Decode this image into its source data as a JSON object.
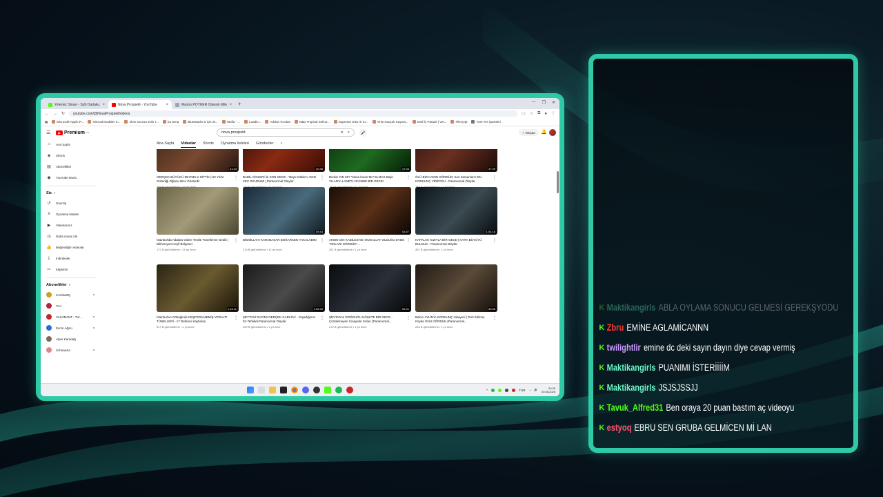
{
  "browser": {
    "tabs": [
      {
        "title": "Yetenez Sinavi - Sizli Dadaku...",
        "color": "#53fc18"
      },
      {
        "title": "Nova Prospekt - YouTube",
        "color": "#ff0000"
      },
      {
        "title": "Masno POYKER Ölüesin Mile...",
        "color": "#9aa5b8"
      }
    ],
    "new_tab_glyph": "+",
    "url": "youtube.com/@NovaProspekt/videos",
    "bookmarks": [
      "Microsoft Apple iP...",
      "Nimrod Modüler K...",
      "ohne soccsu senir t...",
      "bu tema",
      "BlueStacks 5 için W...",
      "Tasfia - ...",
      "Loadin...",
      "Adobe Acrobat",
      "N&D Tropical Select...",
      "Supreset Orta Hi Kr...",
      "Tinie Kauçuk Kayma...",
      "Kedi İç Parazit | Vet...",
      "Filecrypt",
      "Tüm Yer İşaretleri"
    ]
  },
  "youtube": {
    "logo_text": "Premium",
    "logo_sup": "TR",
    "search_value": "nova prospekt",
    "create_label": "Oluştur",
    "sidebar": {
      "main": [
        {
          "icon": "home-icon",
          "glyph": "⌂",
          "label": "Ana Sayfa"
        },
        {
          "icon": "shorts-icon",
          "glyph": "◈",
          "label": "Shorts"
        },
        {
          "icon": "subscriptions-icon",
          "glyph": "▤",
          "label": "Abonelikler"
        },
        {
          "icon": "music-icon",
          "glyph": "◉",
          "label": "YouTube Music"
        }
      ],
      "you_heading": "Siz",
      "you": [
        {
          "icon": "history-icon",
          "glyph": "↺",
          "label": "Geçmiş"
        },
        {
          "icon": "playlists-icon",
          "glyph": "≡",
          "label": "Oynatma listeleri"
        },
        {
          "icon": "your-videos-icon",
          "glyph": "▶",
          "label": "Videolarınız"
        },
        {
          "icon": "watch-later-icon",
          "glyph": "◷",
          "label": "Daha sonra izle"
        },
        {
          "icon": "liked-icon",
          "glyph": "👍",
          "label": "Beğendiğim videolar"
        },
        {
          "icon": "downloads-icon",
          "glyph": "⤓",
          "label": "İndirilenler"
        },
        {
          "icon": "clips-icon",
          "glyph": "✂",
          "label": "Kliplerim"
        }
      ],
      "subs_heading": "Abonelikler",
      "subs": [
        {
          "label": "CombatRy",
          "color": "#c9a030",
          "dot": true
        },
        {
          "label": "TAA",
          "color": "#b8243a",
          "dot": false
        },
        {
          "label": "VALORANT - Tür...",
          "color": "#c4262e",
          "dot": true
        },
        {
          "label": "Evrim Ağacı",
          "color": "#2a6bd4",
          "dot": true
        },
        {
          "label": "Alper Karadağ",
          "color": "#7a6a60",
          "dot": false
        },
        {
          "label": "Schnwsna",
          "color": "#d88a8a",
          "dot": true
        }
      ]
    },
    "channel_tabs": [
      "Ana Sayfa",
      "Videolar",
      "Shorts",
      "Oynatma listeleri",
      "Gönderiler"
    ],
    "active_tab": "Videolar",
    "videos": [
      {
        "title": "GERÇEK BÜYÜCÜ ZEYNEL'e GİTTİK | 60 Yıldır Gizlediği Oğlunu Bize Gösterdi!",
        "meta": "464 B görüntüleme • 10 ay önce",
        "duration": "31:33",
        "bg": "linear-gradient(135deg,#3a2418,#7a4a30 55%,#241410)"
      },
      {
        "title": "BABİL CİNLERİ ile SON GECE - 'Büyü Kitabı'nı SON KEZ OKUDUM! | Paranormal Olaylar",
        "meta": "192 B görüntüleme • 11 ay önce",
        "duration": "40:48",
        "bg": "linear-gradient(135deg,#2a0a08,#8a2a12 50%,#3a0c06)"
      },
      {
        "title": "Bunlar CİN Mİ? Yoksa İnsan Mı? ELMAS Başlı YILAN'ın LANETLİ EVİNDE BİR GECE!",
        "meta": "173 B görüntüleme • 11 ay önce",
        "duration": "47:46",
        "bg": "linear-gradient(135deg,#0a2a0c,#1f6a20 55%,#061a06)"
      },
      {
        "title": "ÖLÜ BİR KADIN GÖRDÜK! Son Zamanların EN KORKUNÇ VİDEOSU - Paranormal Olaylar",
        "meta": "384 B görüntüleme • 11 ay önce",
        "duration": "47:39",
        "bg": "linear-gradient(135deg,#2a1410,#6a3020 50%,#1a0a08)"
      },
      {
        "title": "İstanbul'da Adalara Giden Yeraltı Tünellerine Girdik | Bilinmeyen Keşif Belgesel",
        "meta": "172 B görüntüleme • 11 ay önce",
        "duration": "",
        "bg": "linear-gradient(135deg,#6a6448,#a29a78 50%,#4a4630)"
      },
      {
        "title": "BİSMİLLAH! KARABASAN BOĞARKEN YAKALADIK!",
        "meta": "214 B görüntüleme • 11 ay önce",
        "duration": "59:43",
        "bg": "linear-gradient(135deg,#1a2a3a,#4a6a7a 55%,#101a20)"
      },
      {
        "title": "AMON CİN KABİLESİ'nin MUSALLAT OLDUĞU EVDE \"ONLARI GÖRDÜK\"...",
        "meta": "261 B görüntüleme • 1 yıl önce",
        "duration": "51:57",
        "bg": "linear-gradient(135deg,#1a1008,#5a3018 50%,#0a0604)"
      },
      {
        "title": "KAPALAK KIZIYLA BİR GECE | KARA BÜYÜYÜ BULDUK - Paranormal Olaylar",
        "meta": "467 B görüntüleme • 1 yıl önce",
        "duration": "1:04:18",
        "bg": "linear-gradient(135deg,#0c1418,#3a4a50 55%,#080c10)"
      },
      {
        "title": "İstanbul'un Göbeğinde KEŞFEDİLMEMİŞ YERALTI TÜNELLERİ - 17 Defineci Kayboldu",
        "meta": "517 B görüntüleme • 1 yıl önce",
        "duration": "1:16:11",
        "bg": "linear-gradient(135deg,#2a2414,#6a5a30 50%,#1a1408)"
      },
      {
        "title": "ŞEYTANİ RACİM! GERÇEK CADI EVİ - Yaşadığımız En Tehlikeli Paranormal Olaylar",
        "meta": "359 B görüntüleme • 1 yıl önce",
        "duration": "1:05:40",
        "bg": "linear-gradient(135deg,#1a1a1a,#4a4a4a 55%,#0e0e0e)"
      },
      {
        "title": "ŞEYTAN'ın DOĞDUĞU KÖŞKTE BİR GECE - Çözülemeyen Cinayetin Sırları (Paranormal...",
        "meta": "272 B görüntüleme • 1 yıl önce",
        "duration": "52:01",
        "bg": "linear-gradient(135deg,#0a0c10,#2a3038 55%,#050608)"
      },
      {
        "title": "Bakıcı AYLİN'in KORKUNÇ Hikayesi | Terk Edilmiş Köyde ONU GÖRDÜK (Paranormal...",
        "meta": "263 B görüntüleme • 1 yıl önce",
        "duration": "56:58",
        "bg": "linear-gradient(135deg,#201a14,#5a4a38 50%,#14100a)"
      }
    ],
    "status_url": "https://www.youtube.com/watch?v=Z8Y1mj7azmg"
  },
  "taskbar": {
    "lang": "TUR",
    "time": "20:35",
    "date": "20.08.2025"
  },
  "chat": {
    "messages": [
      {
        "user": "Maktikangirls",
        "text": "ABLA OYLAMA SONUCU GELMESİ GEREKŞYODU",
        "color": "#6df3c4",
        "faded": true
      },
      {
        "user": "Zbru",
        "text": "EMİNE AGLAMİCANNN",
        "color": "#ff3b30",
        "faded": false
      },
      {
        "user": "twilightlir",
        "text": "emine dc deki sayın dayın diye cevap vermiş",
        "color": "#c79bff",
        "faded": false
      },
      {
        "user": "Maktikangirls",
        "text": "PUANIMI İSTERİİİİM",
        "color": "#6df3c4",
        "faded": false
      },
      {
        "user": "Maktikangirls",
        "text": "JSJSJSSJJ",
        "color": "#6df3c4",
        "faded": false
      },
      {
        "user": "Tavuk_Alfred31",
        "text": "Ben oraya 20 puan bastım aç videoyu",
        "color": "#53fc18",
        "faded": false
      },
      {
        "user": "estyoq",
        "text": "EBRU SEN GRUBA GELMİCEN Mİ LAN",
        "color": "#ff4f6d",
        "faded": false
      }
    ]
  }
}
